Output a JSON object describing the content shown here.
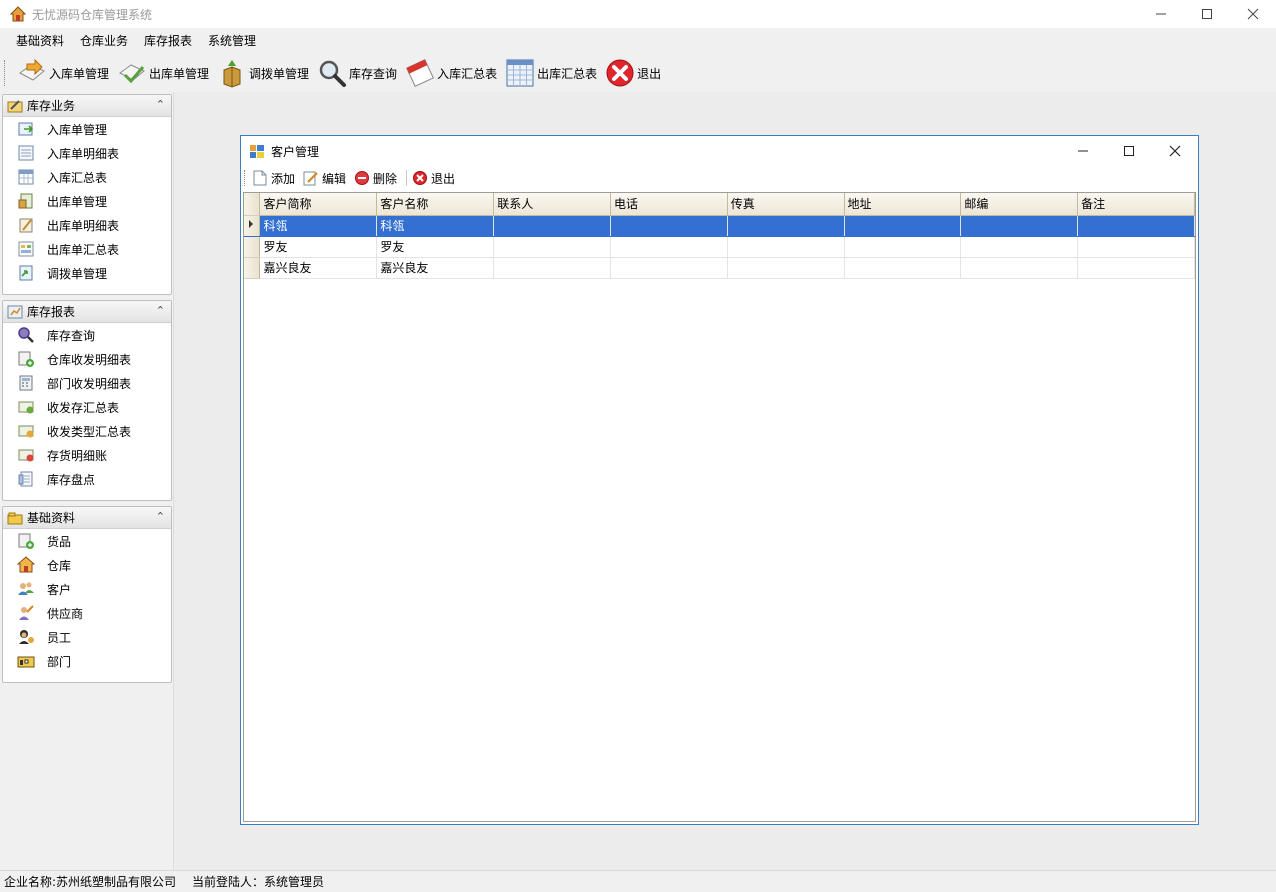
{
  "window": {
    "title": "无忧源码仓库管理系统"
  },
  "menu": [
    "基础资料",
    "仓库业务",
    "库存报表",
    "系统管理"
  ],
  "toolbar": {
    "buttons": [
      {
        "label": "入库单管理",
        "icon": "inbound-icon"
      },
      {
        "label": "出库单管理",
        "icon": "outbound-icon"
      },
      {
        "label": "调拨单管理",
        "icon": "transfer-icon"
      },
      {
        "label": "库存查询",
        "icon": "search-icon"
      },
      {
        "label": "入库汇总表",
        "icon": "calendar-icon"
      },
      {
        "label": "出库汇总表",
        "icon": "grid-icon"
      },
      {
        "label": "退出",
        "icon": "exit-icon"
      }
    ]
  },
  "sidebar": {
    "groups": [
      {
        "title": "库存业务",
        "items": [
          "入库单管理",
          "入库单明细表",
          "入库汇总表",
          "出库单管理",
          "出库单明细表",
          "出库单汇总表",
          "调拨单管理"
        ]
      },
      {
        "title": "库存报表",
        "items": [
          "库存查询",
          "仓库收发明细表",
          "部门收发明细表",
          "收发存汇总表",
          "收发类型汇总表",
          "存货明细账",
          "库存盘点"
        ]
      },
      {
        "title": "基础资料",
        "items": [
          "货品",
          "仓库",
          "客户",
          "供应商",
          "员工",
          "部门"
        ]
      }
    ]
  },
  "child_window": {
    "title": "客户管理",
    "toolbar": [
      "添加",
      "编辑",
      "删除",
      "退出"
    ],
    "table": {
      "columns": [
        "客户简称",
        "客户名称",
        "联系人",
        "电话",
        "传真",
        "地址",
        "邮编",
        "备注"
      ],
      "rows": [
        [
          "科瓴",
          "科瓴",
          "",
          "",
          "",
          "",
          "",
          ""
        ],
        [
          "罗友",
          "罗友",
          "",
          "",
          "",
          "",
          "",
          ""
        ],
        [
          "嘉兴良友",
          "嘉兴良友",
          "",
          "",
          "",
          "",
          "",
          ""
        ]
      ],
      "selected_row": 0
    }
  },
  "status": {
    "company": "企业名称:苏州纸塑制品有限公司",
    "user": "当前登陆人：系统管理员"
  },
  "colors": {
    "selection": "#3370d1",
    "window_border": "#3c7fc0"
  }
}
